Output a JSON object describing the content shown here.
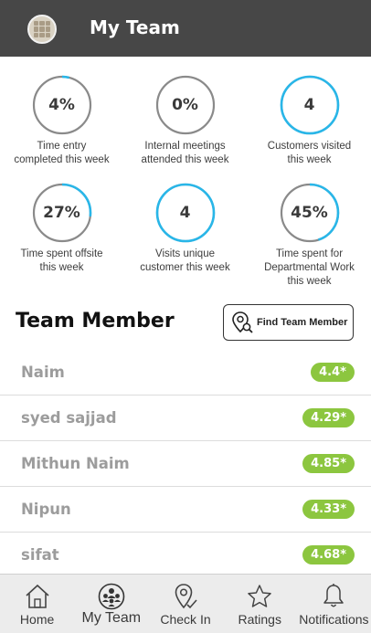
{
  "header": {
    "title": "My Team"
  },
  "stats": [
    {
      "value": "4%",
      "label_line1": "Time entry",
      "label_line2": "completed this week",
      "label_line3": "",
      "progress": 0.04
    },
    {
      "value": "0%",
      "label_line1": "Internal meetings",
      "label_line2": "attended this week",
      "label_line3": "",
      "progress": 0.0
    },
    {
      "value": "4",
      "label_line1": "Customers visited",
      "label_line2": "this week",
      "label_line3": "",
      "progress": 1.0
    },
    {
      "value": "27%",
      "label_line1": "Time spent offsite",
      "label_line2": "this week",
      "label_line3": "",
      "progress": 0.27
    },
    {
      "value": "4",
      "label_line1": "Visits unique",
      "label_line2": "customer this week",
      "label_line3": "",
      "progress": 1.0
    },
    {
      "value": "45%",
      "label_line1": "Time spent for",
      "label_line2": "Departmental Work",
      "label_line3": "this week",
      "progress": 0.45
    }
  ],
  "colors": {
    "ring_track": "#8a8a8a",
    "ring_progress": "#29b6e8",
    "header_bg": "#474747",
    "badge_bg": "#8cc63f"
  },
  "team": {
    "title": "Team Member",
    "find_button_label": "Find Team Member",
    "members": [
      {
        "name": "Naim",
        "rating": "4.4*"
      },
      {
        "name": "syed sajjad",
        "rating": "4.29*"
      },
      {
        "name": "Mithun Naim",
        "rating": "4.85*"
      },
      {
        "name": "Nipun",
        "rating": "4.33*"
      },
      {
        "name": "sifat",
        "rating": "4.68*"
      }
    ]
  },
  "nav": {
    "home": {
      "label": "Home",
      "icon": "home-icon"
    },
    "my_team": {
      "label": "My Team",
      "icon": "team-icon"
    },
    "check_in": {
      "label": "Check In",
      "icon": "location-icon"
    },
    "ratings": {
      "label": "Ratings",
      "icon": "star-icon"
    },
    "notifications": {
      "label": "Notifications",
      "icon": "bell-icon"
    }
  }
}
